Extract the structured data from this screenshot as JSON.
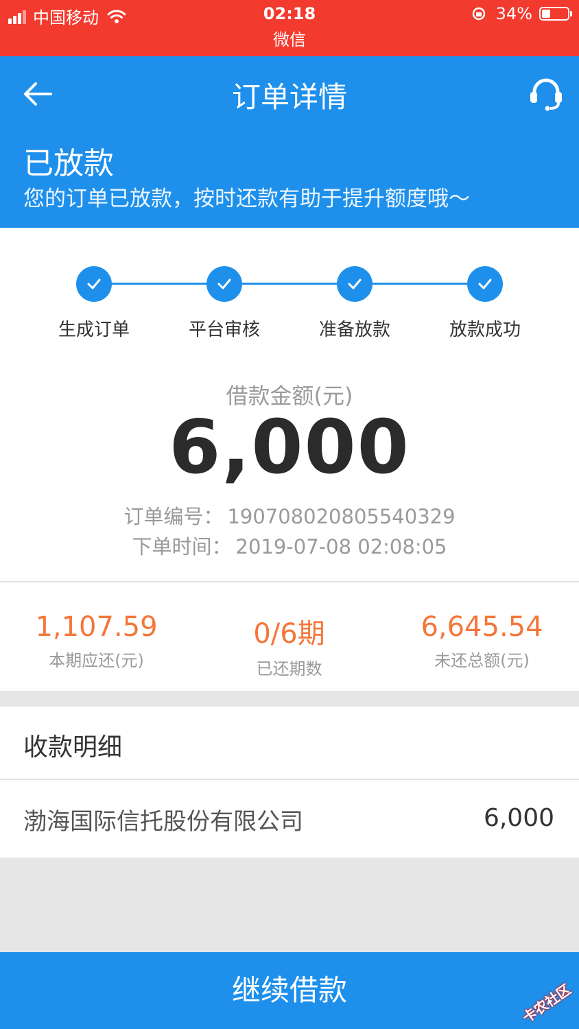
{
  "status_bar": {
    "carrier": "中国移动",
    "time": "02:18",
    "app": "微信",
    "battery": "34%"
  },
  "header": {
    "title": "订单详情",
    "status_title": "已放款",
    "status_desc": "您的订单已放款，按时还款有助于提升额度哦～",
    "back_icon": "back-arrow-icon",
    "support_icon": "headset-icon"
  },
  "steps": [
    {
      "label": "生成订单"
    },
    {
      "label": "平台审核"
    },
    {
      "label": "准备放款"
    },
    {
      "label": "放款成功"
    }
  ],
  "loan": {
    "amount_label": "借款金额(元)",
    "amount": "6,000",
    "order_no_label": "订单编号：",
    "order_no": "190708020805540329",
    "order_time_label": "下单时间：",
    "order_time": "2019-07-08 02:08:05"
  },
  "stats": [
    {
      "value": "1,107.59",
      "label": "本期应还(元)"
    },
    {
      "value": "0/6期",
      "label": "已还期数"
    },
    {
      "value": "6,645.54",
      "label": "未还总额(元)"
    }
  ],
  "receipt": {
    "title": "收款明细",
    "company": "渤海国际信托股份有限公司",
    "amount": "6,000"
  },
  "bottom_button": "继续借款",
  "watermark": "卡农社区",
  "colors": {
    "status_bar": "#f33a2e",
    "primary": "#1e90ec",
    "accent": "#f4773a"
  }
}
